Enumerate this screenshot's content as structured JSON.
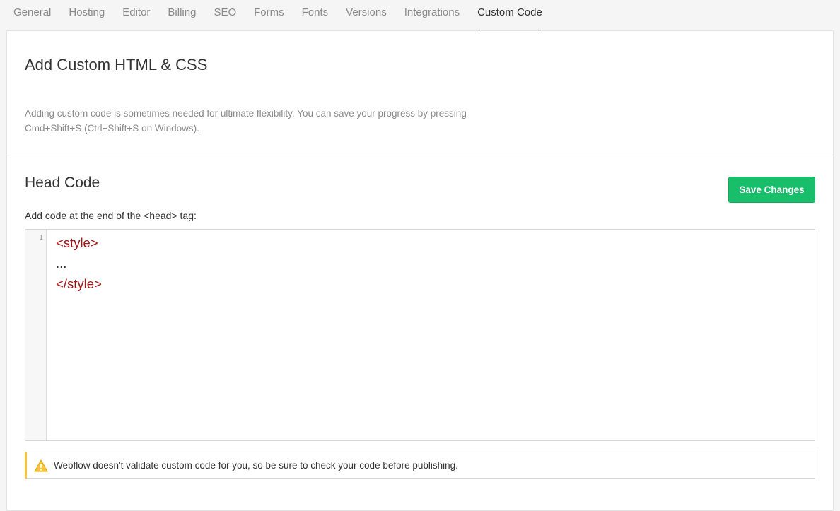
{
  "tabs": [
    {
      "label": "General"
    },
    {
      "label": "Hosting"
    },
    {
      "label": "Editor"
    },
    {
      "label": "Billing"
    },
    {
      "label": "SEO"
    },
    {
      "label": "Forms"
    },
    {
      "label": "Fonts"
    },
    {
      "label": "Versions"
    },
    {
      "label": "Integrations"
    },
    {
      "label": "Custom Code",
      "active": true
    }
  ],
  "intro": {
    "title": "Add Custom HTML & CSS",
    "description": "Adding custom code is sometimes needed for ultimate flexibility. You can save your progress by pressing Cmd+Shift+S (Ctrl+Shift+S on Windows)."
  },
  "head_code": {
    "title": "Head Code",
    "save_label": "Save Changes",
    "field_label": "Add code at the end of the <head> tag:",
    "line_number": "1",
    "code_lines": [
      "<style>",
      "...",
      "</style>"
    ]
  },
  "warning": {
    "icon": "warning-icon",
    "text": "Webflow doesn't validate custom code for you, so be sure to check your code before publishing."
  },
  "colors": {
    "accent": "#19be6b",
    "warning": "#f5c242",
    "code_tag": "#a31515"
  }
}
